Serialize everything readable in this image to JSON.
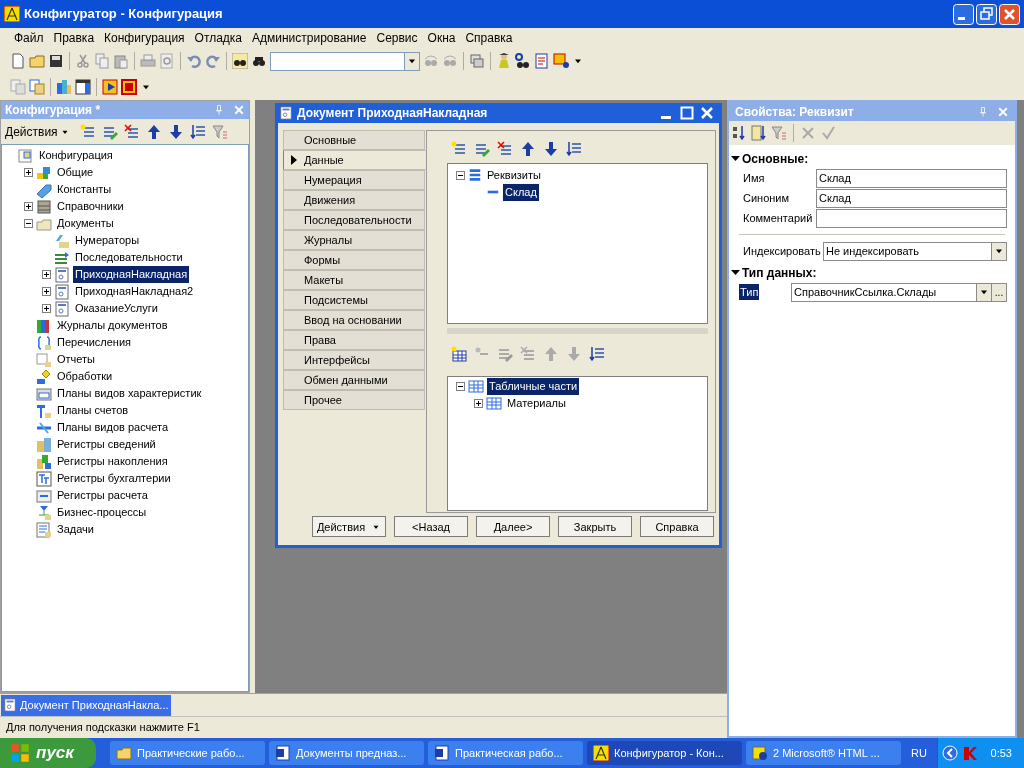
{
  "window": {
    "title": "Конфигуратор - Конфигурация"
  },
  "menu": [
    "Файл",
    "Правка",
    "Конфигурация",
    "Отладка",
    "Администрирование",
    "Сервис",
    "Окна",
    "Справка"
  ],
  "config_panel": {
    "title": "Конфигурация *",
    "actions": "Действия",
    "tree": [
      {
        "label": "Конфигурация",
        "selected": false,
        "children": [
          {
            "label": "Общие",
            "expanded": false,
            "selected": false
          },
          {
            "label": "Константы",
            "selected": false
          },
          {
            "label": "Справочники",
            "expanded": false,
            "selected": false
          },
          {
            "label": "Документы",
            "expanded": true,
            "selected": false,
            "children": [
              {
                "label": "Нумераторы",
                "selected": false
              },
              {
                "label": "Последовательности",
                "selected": false
              },
              {
                "label": "ПриходнаяНакладная",
                "expanded": false,
                "selected": true
              },
              {
                "label": "ПриходнаяНакладная2",
                "expanded": false,
                "selected": false
              },
              {
                "label": "ОказаниеУслуги",
                "expanded": false,
                "selected": false
              }
            ]
          },
          {
            "label": "Журналы документов",
            "selected": false
          },
          {
            "label": "Перечисления",
            "selected": false
          },
          {
            "label": "Отчеты",
            "selected": false
          },
          {
            "label": "Обработки",
            "selected": false
          },
          {
            "label": "Планы видов характеристик",
            "selected": false
          },
          {
            "label": "Планы счетов",
            "selected": false
          },
          {
            "label": "Планы видов расчета",
            "selected": false
          },
          {
            "label": "Регистры сведений",
            "selected": false
          },
          {
            "label": "Регистры накопления",
            "selected": false
          },
          {
            "label": "Регистры бухгалтерии",
            "selected": false
          },
          {
            "label": "Регистры расчета",
            "selected": false
          },
          {
            "label": "Бизнес-процессы",
            "selected": false
          },
          {
            "label": "Задачи",
            "selected": false
          }
        ]
      }
    ]
  },
  "dialog": {
    "title": "Документ ПриходнаяНакладная",
    "tabs": [
      {
        "label": "Основные",
        "selected": false
      },
      {
        "label": "Данные",
        "selected": true
      },
      {
        "label": "Нумерация",
        "selected": false
      },
      {
        "label": "Движения",
        "selected": false
      },
      {
        "label": "Последовательности",
        "selected": false
      },
      {
        "label": "Журналы",
        "selected": false
      },
      {
        "label": "Формы",
        "selected": false
      },
      {
        "label": "Макеты",
        "selected": false
      },
      {
        "label": "Подсистемы",
        "selected": false
      },
      {
        "label": "Ввод на основании",
        "selected": false
      },
      {
        "label": "Права",
        "selected": false
      },
      {
        "label": "Интерфейсы",
        "selected": false
      },
      {
        "label": "Обмен данными",
        "selected": false
      },
      {
        "label": "Прочее",
        "selected": false
      }
    ],
    "attributes_tree": [
      {
        "label": "Реквизиты",
        "expanded": true,
        "selected": false,
        "children": [
          {
            "label": "Склад",
            "selected": true
          }
        ]
      }
    ],
    "tables_tree": [
      {
        "label": "Табличные части",
        "expanded": true,
        "selected": true,
        "children": [
          {
            "label": "Материалы",
            "expanded": false,
            "selected": false
          }
        ]
      }
    ],
    "buttons": [
      {
        "label": "Действия",
        "kind": "menu"
      },
      {
        "label": "<Назад",
        "kind": "plain"
      },
      {
        "label": "Далее>",
        "kind": "plain"
      },
      {
        "label": "Закрыть",
        "kind": "plain"
      },
      {
        "label": "Справка",
        "kind": "plain"
      }
    ]
  },
  "properties": {
    "title": "Свойства: Реквизит",
    "sections": [
      {
        "label": "Основные:",
        "expanded": true,
        "rows": [
          {
            "label": "Имя",
            "value": "Склад",
            "kind": "text",
            "selected": false
          },
          {
            "label": "Синоним",
            "value": "Склад",
            "kind": "text",
            "selected": false
          },
          {
            "label": "Комментарий",
            "kind": "text",
            "selected": false
          },
          {
            "label": "Индексировать",
            "value": "Не индексировать",
            "kind": "select",
            "selected": false
          }
        ]
      },
      {
        "label": "Тип данных:",
        "expanded": true,
        "rows": [
          {
            "label": "Тип",
            "value": "СправочникСсылка.Склады",
            "kind": "type",
            "button": "...",
            "selected": true
          }
        ]
      }
    ]
  },
  "window_tabs": [
    {
      "label": "Документ ПриходнаяНакла...",
      "selected": true
    }
  ],
  "status_bar": "Для получения подсказки нажмите F1",
  "taskbar": {
    "start": "пуск",
    "items": [
      {
        "label": "Практические рабо...",
        "selected": false
      },
      {
        "label": "Документы предназ...",
        "selected": false
      },
      {
        "label": "Практическая рабо...",
        "selected": false
      },
      {
        "label": "Конфигуратор - Кон...",
        "selected": true
      },
      {
        "label": "2 Microsoft® HTML ...",
        "selected": false
      }
    ],
    "language": "RU",
    "clock": "0:53"
  }
}
